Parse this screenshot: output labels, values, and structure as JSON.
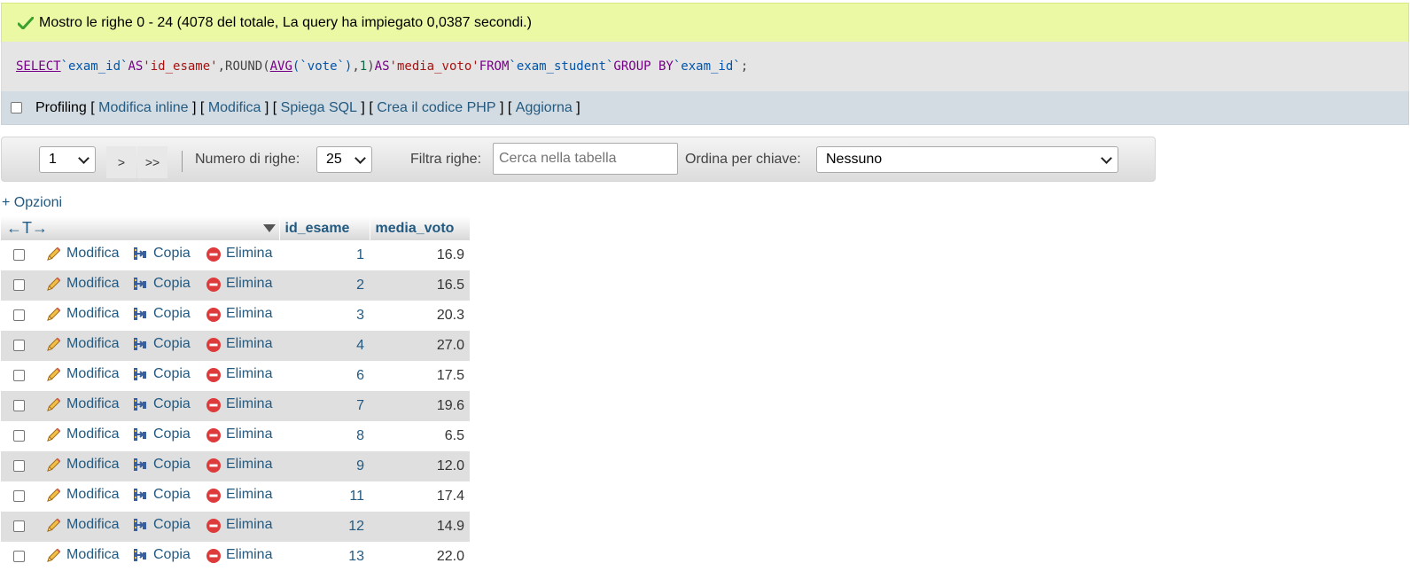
{
  "message": {
    "text": "Mostro le righe 0 - 24 (4078 del totale, La query ha impiegato 0,0387 secondi.)"
  },
  "sql": {
    "select": "SELECT",
    "id_col": " `exam_id` ",
    "as1": "AS",
    "alias1": " 'id_esame'",
    "comma": ", ",
    "round": "ROUND",
    "paren_open": "(",
    "avg": "AVG",
    "vote_col": "(`vote`)",
    "comma2": ", ",
    "one": "1",
    "paren_close": ") ",
    "as2": "AS",
    "alias2": " 'media_voto' ",
    "from": "FROM",
    "table": " `exam_student` ",
    "group_by": "GROUP BY",
    "group_col": " `exam_id`",
    "semicolon": ";"
  },
  "tools": {
    "profiling": "Profiling",
    "open_bracket": "[",
    "close_bracket": "]",
    "modifica_inline": "Modifica inline",
    "modifica": "Modifica",
    "spiega_sql": "Spiega SQL",
    "crea_php": "Crea il codice PHP",
    "aggiorna": "Aggiorna"
  },
  "nav": {
    "page_value": "1",
    "next": ">",
    "last": ">>",
    "rows_label": "Numero di righe:",
    "rows_value": "25",
    "filter_label": "Filtra righe:",
    "filter_placeholder": "Cerca nella tabella",
    "sort_label": "Ordina per chiave:",
    "sort_value": "Nessuno"
  },
  "options_link": "+ Opzioni",
  "table": {
    "arrows": "←T→",
    "headers": [
      "id_esame",
      "media_voto"
    ],
    "actions": {
      "edit": "Modifica",
      "copy": "Copia",
      "delete": "Elimina"
    },
    "rows": [
      {
        "id": "1",
        "avg": "16.9"
      },
      {
        "id": "2",
        "avg": "16.5"
      },
      {
        "id": "3",
        "avg": "20.3"
      },
      {
        "id": "4",
        "avg": "27.0"
      },
      {
        "id": "6",
        "avg": "17.5"
      },
      {
        "id": "7",
        "avg": "19.6"
      },
      {
        "id": "8",
        "avg": "6.5"
      },
      {
        "id": "9",
        "avg": "12.0"
      },
      {
        "id": "11",
        "avg": "17.4"
      },
      {
        "id": "12",
        "avg": "14.9"
      },
      {
        "id": "13",
        "avg": "22.0"
      }
    ]
  },
  "colors": {
    "success_bg": "#ebf8a4",
    "link": "#235a81",
    "row_alt": "#dfdfdf",
    "tools_bg": "#d3dce3"
  }
}
